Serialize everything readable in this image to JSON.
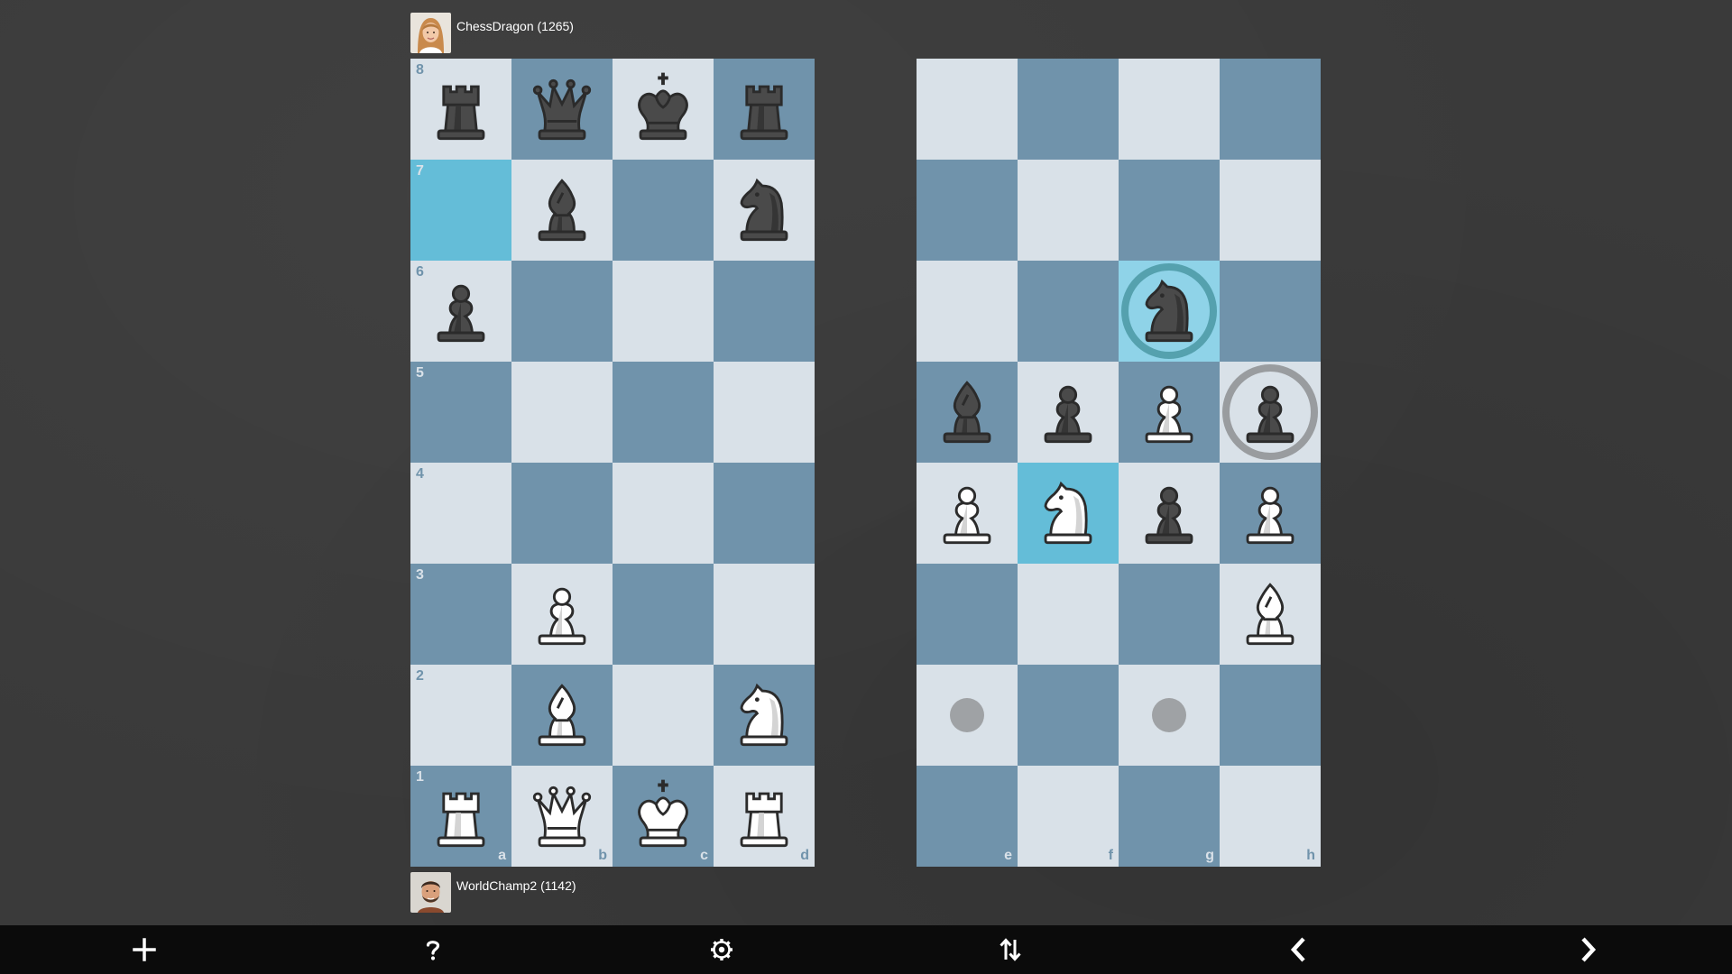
{
  "players": {
    "top": {
      "name": "ChessDragon (1265)"
    },
    "bottom": {
      "name": "WorldChamp2 (1142)"
    }
  },
  "colors": {
    "light_square": "#d9e1e8",
    "dark_square": "#7093ab",
    "highlight": "#64bdd8",
    "background": "#3a3a3a",
    "toolbar": "#0b0b0b"
  },
  "files": [
    "a",
    "b",
    "c",
    "d",
    "e",
    "f",
    "g",
    "h"
  ],
  "ranks": [
    "8",
    "7",
    "6",
    "5",
    "4",
    "3",
    "2",
    "1"
  ],
  "board": {
    "8": [
      "bR",
      "bQ",
      "bK",
      "bR",
      "",
      "",
      "",
      ""
    ],
    "7": [
      "",
      "bB",
      "",
      "bN",
      "",
      "",
      "",
      ""
    ],
    "6": [
      "bP",
      "",
      "",
      "",
      "",
      "",
      "bN",
      ""
    ],
    "5": [
      "",
      "",
      "",
      "",
      "bB",
      "bP",
      "wP",
      "bP"
    ],
    "4": [
      "",
      "",
      "",
      "",
      "wP",
      "wN",
      "bP",
      "wP"
    ],
    "3": [
      "",
      "wP",
      "",
      "",
      "",
      "",
      "",
      "wB"
    ],
    "2": [
      "",
      "wB",
      "",
      "wN",
      "",
      "",
      "",
      ""
    ],
    "1": [
      "wR",
      "wQ",
      "wK",
      "wR",
      "",
      "",
      "",
      ""
    ]
  },
  "highlighted_squares": [
    "a7",
    "f4"
  ],
  "selected_square": "g6",
  "capture_targets": [
    "g6",
    "h5"
  ],
  "move_dots": [
    "e2",
    "g2"
  ],
  "toolbar": [
    {
      "name": "new-game-button",
      "icon": "plus-icon"
    },
    {
      "name": "help-button",
      "icon": "question-icon"
    },
    {
      "name": "settings-button",
      "icon": "gear-icon"
    },
    {
      "name": "flip-board-button",
      "icon": "swap-arrows-icon"
    },
    {
      "name": "previous-move-button",
      "icon": "chevron-left-icon"
    },
    {
      "name": "next-move-button",
      "icon": "chevron-right-icon"
    }
  ]
}
